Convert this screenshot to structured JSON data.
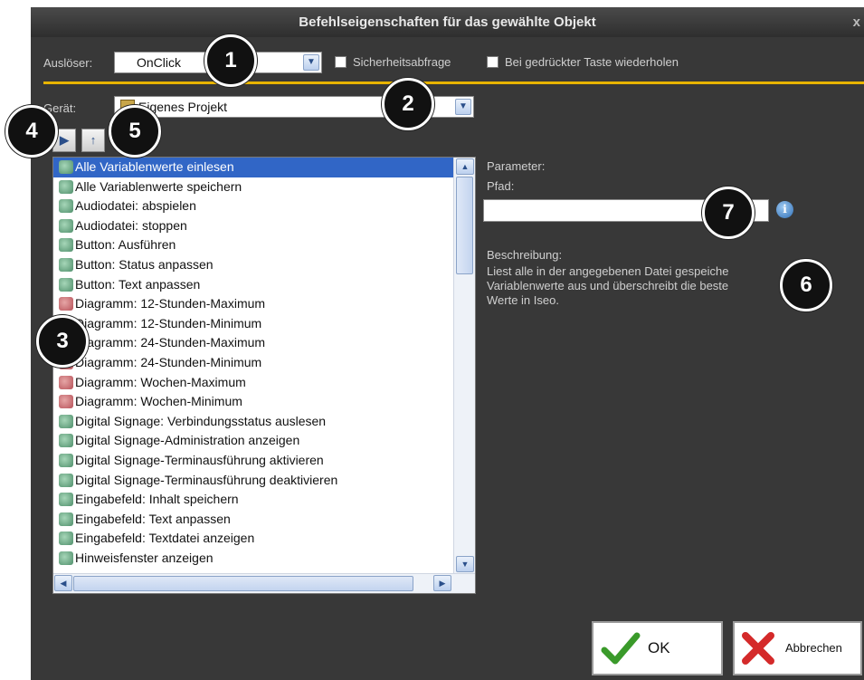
{
  "window": {
    "title": "Befehlseigenschaften für das gewählte Objekt",
    "close_glyph": "x"
  },
  "trigger": {
    "label": "Auslöser:",
    "value": "OnClick",
    "options_checkbox_1": "Sicherheitsabfrage",
    "options_checkbox_2": "Bei gedrückter Taste wiederholen"
  },
  "device": {
    "label": "Gerät:",
    "value": "Eigenes Projekt"
  },
  "toolbar": {
    "expand_icon": "play-icon",
    "sort_icon": "sort-az-icon"
  },
  "commands": [
    {
      "label": "Alle Variablenwerte einlesen",
      "icon": "green",
      "selected": true
    },
    {
      "label": "Alle Variablenwerte speichern",
      "icon": "green"
    },
    {
      "label": "Audiodatei: abspielen",
      "icon": "green"
    },
    {
      "label": "Audiodatei: stoppen",
      "icon": "green"
    },
    {
      "label": "Button: Ausführen",
      "icon": "green"
    },
    {
      "label": "Button: Status anpassen",
      "icon": "green"
    },
    {
      "label": "Button: Text anpassen",
      "icon": "green"
    },
    {
      "label": "Diagramm: 12-Stunden-Maximum",
      "icon": "red"
    },
    {
      "label": "Diagramm: 12-Stunden-Minimum",
      "icon": "red"
    },
    {
      "label": "Diagramm: 24-Stunden-Maximum",
      "icon": "red"
    },
    {
      "label": "Diagramm: 24-Stunden-Minimum",
      "icon": "red"
    },
    {
      "label": "Diagramm: Wochen-Maximum",
      "icon": "red"
    },
    {
      "label": "Diagramm: Wochen-Minimum",
      "icon": "red"
    },
    {
      "label": "Digital Signage: Verbindungsstatus auslesen",
      "icon": "green"
    },
    {
      "label": "Digital Signage-Administration anzeigen",
      "icon": "green"
    },
    {
      "label": "Digital Signage-Terminausführung aktivieren",
      "icon": "green"
    },
    {
      "label": "Digital Signage-Terminausführung deaktivieren",
      "icon": "green"
    },
    {
      "label": "Eingabefeld: Inhalt speichern",
      "icon": "green"
    },
    {
      "label": "Eingabefeld: Text anpassen",
      "icon": "green"
    },
    {
      "label": "Eingabefeld: Textdatei anzeigen",
      "icon": "green"
    },
    {
      "label": "Hinweisfenster anzeigen",
      "icon": "green"
    }
  ],
  "parameters": {
    "heading": "Parameter:",
    "path_label": "Pfad:",
    "path_value": "",
    "info_glyph": "i"
  },
  "description": {
    "heading": "Beschreibung:",
    "text": "Liest alle in der angegebenen Datei gespeiche\nVariablenwerte aus und überschreibt die beste\nWerte in Iseo."
  },
  "buttons": {
    "ok": "OK",
    "cancel": "Abbrechen"
  },
  "callouts": [
    "1",
    "2",
    "3",
    "4",
    "5",
    "6",
    "7"
  ],
  "colors": {
    "accent_line": "#e8b400",
    "selection": "#3166c6",
    "ok_check": "#3a9a2a",
    "cancel_x": "#d42a2a"
  }
}
